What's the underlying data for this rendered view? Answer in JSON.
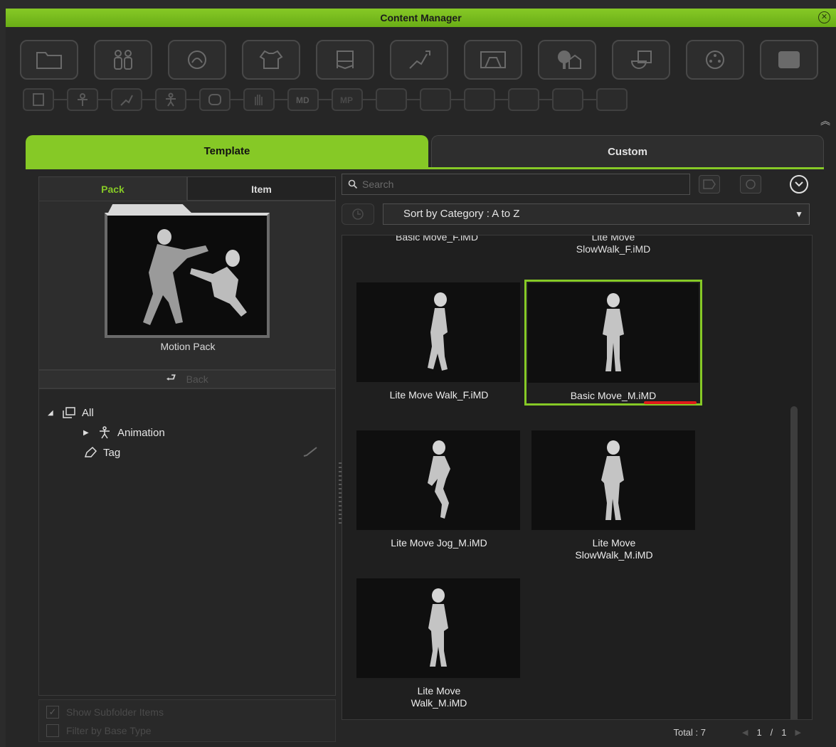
{
  "window": {
    "title": "Content Manager",
    "close_icon": "close-circle-icon"
  },
  "toolbar_row1": [
    "folder-icon",
    "actors-icon",
    "head-rotate-icon",
    "clothing-icon",
    "set-icon",
    "motion-icon",
    "stage-icon",
    "trees-icon",
    "props-icon",
    "camera-reel-icon",
    "screen-icon"
  ],
  "toolbar_row2": [
    "document-icon",
    "pose-icon",
    "run-icon",
    "figure-icon",
    "face-icon",
    "hand-icon",
    "md-icon",
    "mp-icon",
    "empty-slot",
    "empty-slot",
    "empty-slot",
    "empty-slot",
    "empty-slot",
    "empty-slot",
    "empty-slot"
  ],
  "main_tabs": {
    "template": "Template",
    "custom": "Custom"
  },
  "sub_tabs": {
    "pack": "Pack",
    "item": "Item"
  },
  "pack": {
    "label": "Motion Pack",
    "back": "Back"
  },
  "tree": {
    "all": "All",
    "animation": "Animation",
    "tag": "Tag"
  },
  "options": {
    "show_subfolder": "Show Subfolder Items",
    "filter_base": "Filter by Base Type"
  },
  "search": {
    "placeholder": "Search"
  },
  "sort": {
    "value": "Sort by Category : A to Z"
  },
  "items_partial": [
    {
      "label": "Basic Move_F.iMD"
    },
    {
      "label": "Lite Move\nSlowWalk_F.iMD"
    }
  ],
  "items": [
    {
      "label": "Lite Move Walk_F.iMD",
      "selected": false
    },
    {
      "label": "Basic Move_M.iMD",
      "selected": true
    },
    {
      "label": "Lite Move Jog_M.iMD",
      "selected": false
    },
    {
      "label": "Lite Move\nSlowWalk_M.iMD",
      "selected": false
    },
    {
      "label": "Lite Move\nWalk_M.iMD",
      "selected": false
    }
  ],
  "footer": {
    "total": "Total : 7",
    "page": "1",
    "sep": "/",
    "pages": "1"
  },
  "colors": {
    "accent": "#86c926",
    "highlight": "#e01a1a"
  }
}
